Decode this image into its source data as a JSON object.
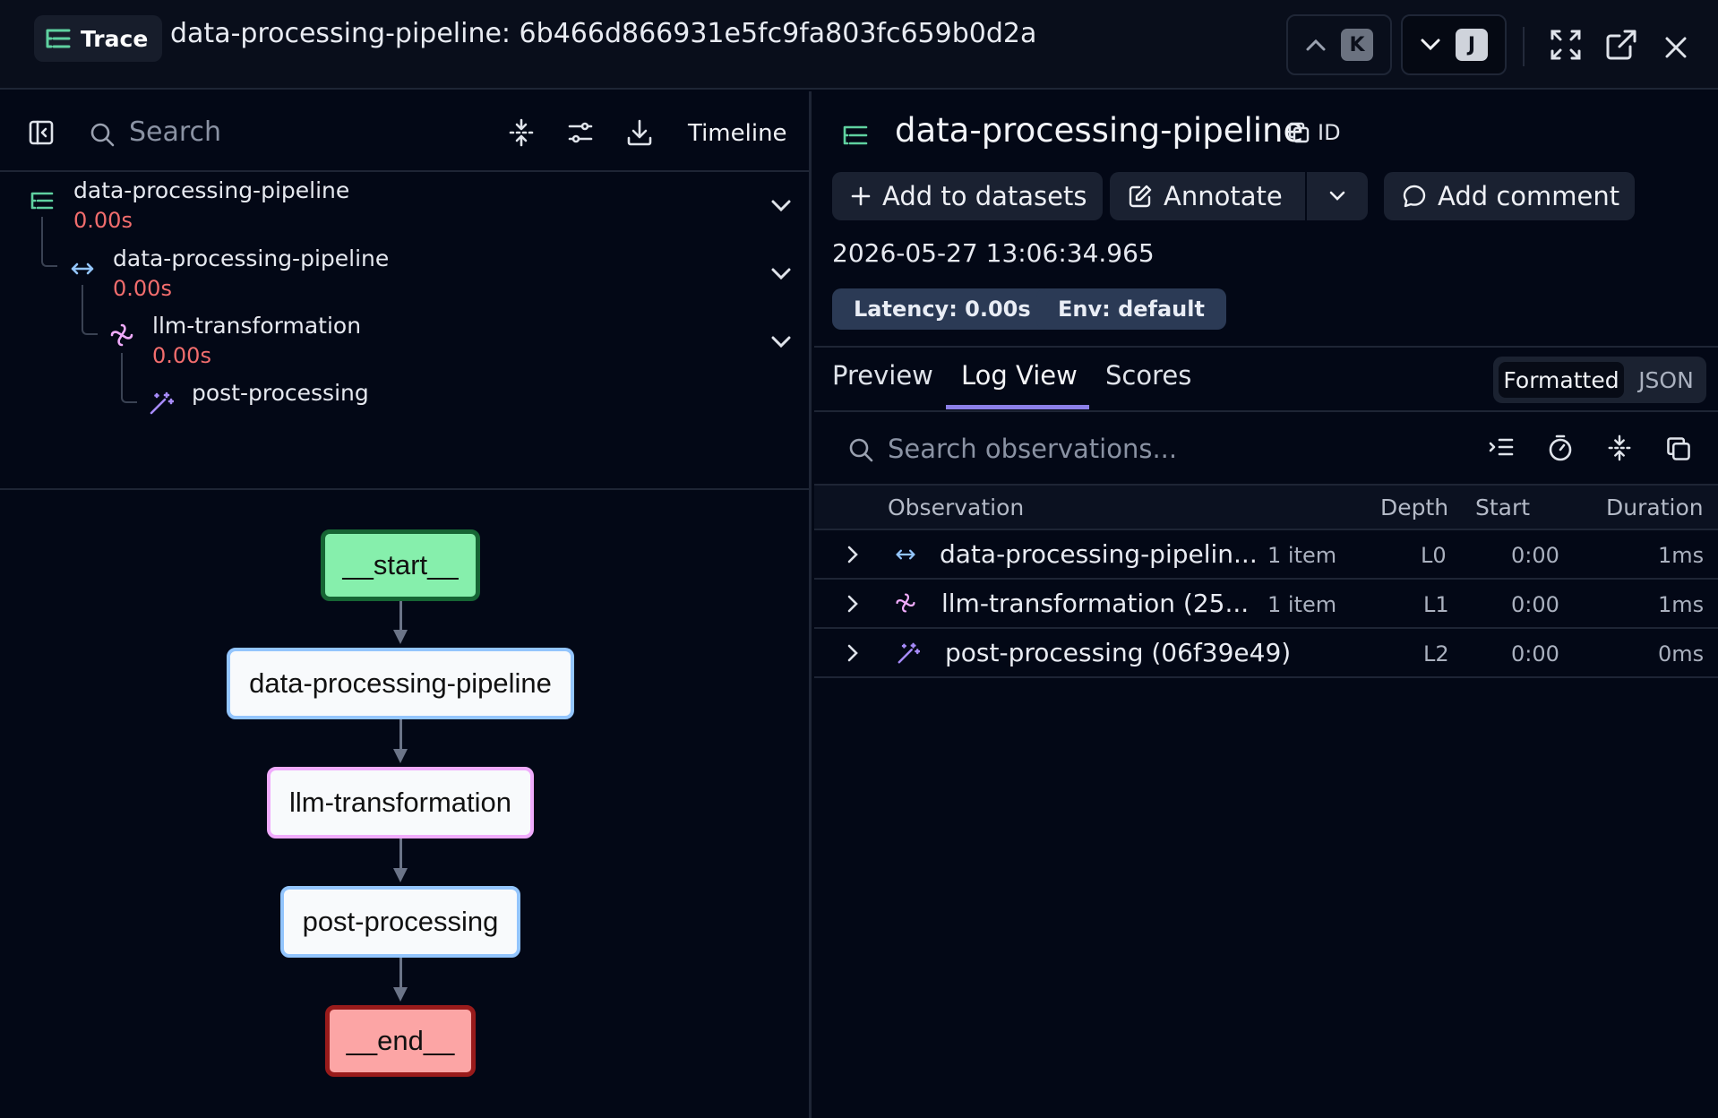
{
  "header": {
    "badge_label": "Trace",
    "title": "data-processing-pipeline: 6b466d866931e5fc9fa803fc659b0d2a",
    "prev_key": "K",
    "next_key": "J"
  },
  "left": {
    "search_placeholder": "Search",
    "timeline_label": "Timeline",
    "tree": [
      {
        "name": "data-processing-pipeline",
        "time": "0.00s",
        "icon": "trace-icon"
      },
      {
        "name": "data-processing-pipeline",
        "time": "0.00s",
        "icon": "span-arrows-icon"
      },
      {
        "name": "llm-transformation",
        "time": "0.00s",
        "icon": "generation-icon"
      },
      {
        "name": "post-processing",
        "time": "",
        "icon": "wand-icon"
      }
    ],
    "graph_nodes": [
      "__start__",
      "data-processing-pipeline",
      "llm-transformation",
      "post-processing",
      "__end__"
    ]
  },
  "right": {
    "title": "data-processing-pipeline",
    "id_label": "ID",
    "add_to_datasets": "Add to datasets",
    "annotate": "Annotate",
    "add_comment": "Add comment",
    "timestamp": "2026-05-27 13:06:34.965",
    "latency": "Latency: 0.00s",
    "env": "Env: default",
    "tabs": [
      "Preview",
      "Log View",
      "Scores"
    ],
    "active_tab": "Log View",
    "view_formatted": "Formatted",
    "view_json": "JSON",
    "obs_search_placeholder": "Search observations...",
    "columns": [
      "Observation",
      "Depth",
      "Start",
      "Duration"
    ],
    "rows": [
      {
        "name": "data-processing-pipelin...",
        "items": "1 item",
        "depth": "L0",
        "start": "0:00",
        "duration": "1ms"
      },
      {
        "name": "llm-transformation (25...",
        "items": "1 item",
        "depth": "L1",
        "start": "0:00",
        "duration": "1ms"
      },
      {
        "name": "post-processing (06f39e49)",
        "items": "",
        "depth": "L2",
        "start": "0:00",
        "duration": "0ms"
      }
    ]
  },
  "colors": {
    "accent_tab": "#8b7fe8",
    "time_red": "#f26d6d",
    "start_node": "#86efac",
    "end_node": "#fca5a5",
    "span_blue": "#93c5fd",
    "generation_pink": "#f0abfc"
  }
}
